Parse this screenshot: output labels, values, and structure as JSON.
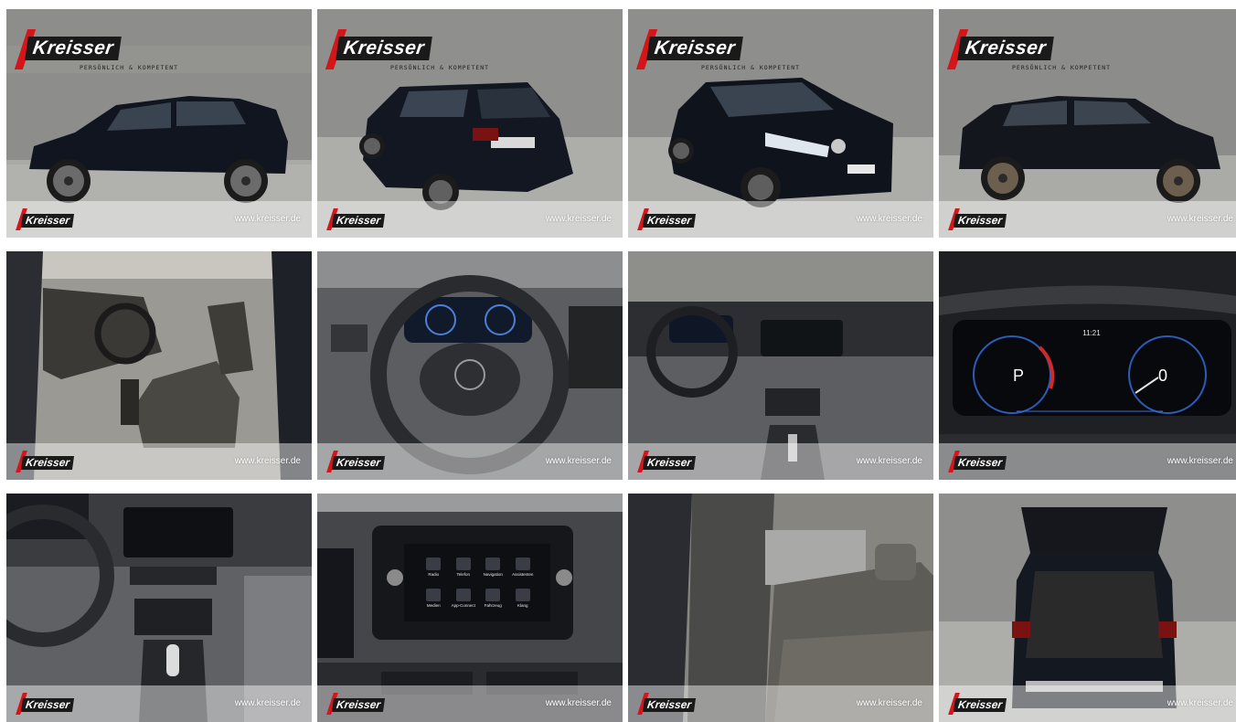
{
  "brand": {
    "name": "Kreisser",
    "slogan": "PERSÖNLICH & KOMPETENT",
    "footer_url": "www.kreisser.de",
    "colors": {
      "red": "#d4151a",
      "dark": "#1a1a1a"
    }
  },
  "gallery": {
    "photos": [
      {
        "subject": "exterior-side-view",
        "has_logo_header": true
      },
      {
        "subject": "exterior-rear-three-quarter",
        "has_logo_header": true
      },
      {
        "subject": "exterior-front-three-quarter",
        "has_logo_header": true
      },
      {
        "subject": "exterior-side-view-right",
        "has_logo_header": true
      },
      {
        "subject": "interior-front-seats",
        "has_logo_header": false
      },
      {
        "subject": "steering-wheel",
        "has_logo_header": false
      },
      {
        "subject": "dashboard-overview",
        "has_logo_header": false
      },
      {
        "subject": "digital-cockpit",
        "has_logo_header": false
      },
      {
        "subject": "center-console",
        "has_logo_header": false
      },
      {
        "subject": "infotainment-screen",
        "has_logo_header": false
      },
      {
        "subject": "rear-seats",
        "has_logo_header": false
      },
      {
        "subject": "open-trunk",
        "has_logo_header": false
      }
    ],
    "cockpit": {
      "gear": "P",
      "speed": "0",
      "time": "11:21"
    },
    "infotainment_menu": [
      "Radio",
      "Telefon",
      "Navigation",
      "Assistenten",
      "Medien",
      "App-Connect",
      "Fahrzeug",
      "Klang"
    ]
  }
}
